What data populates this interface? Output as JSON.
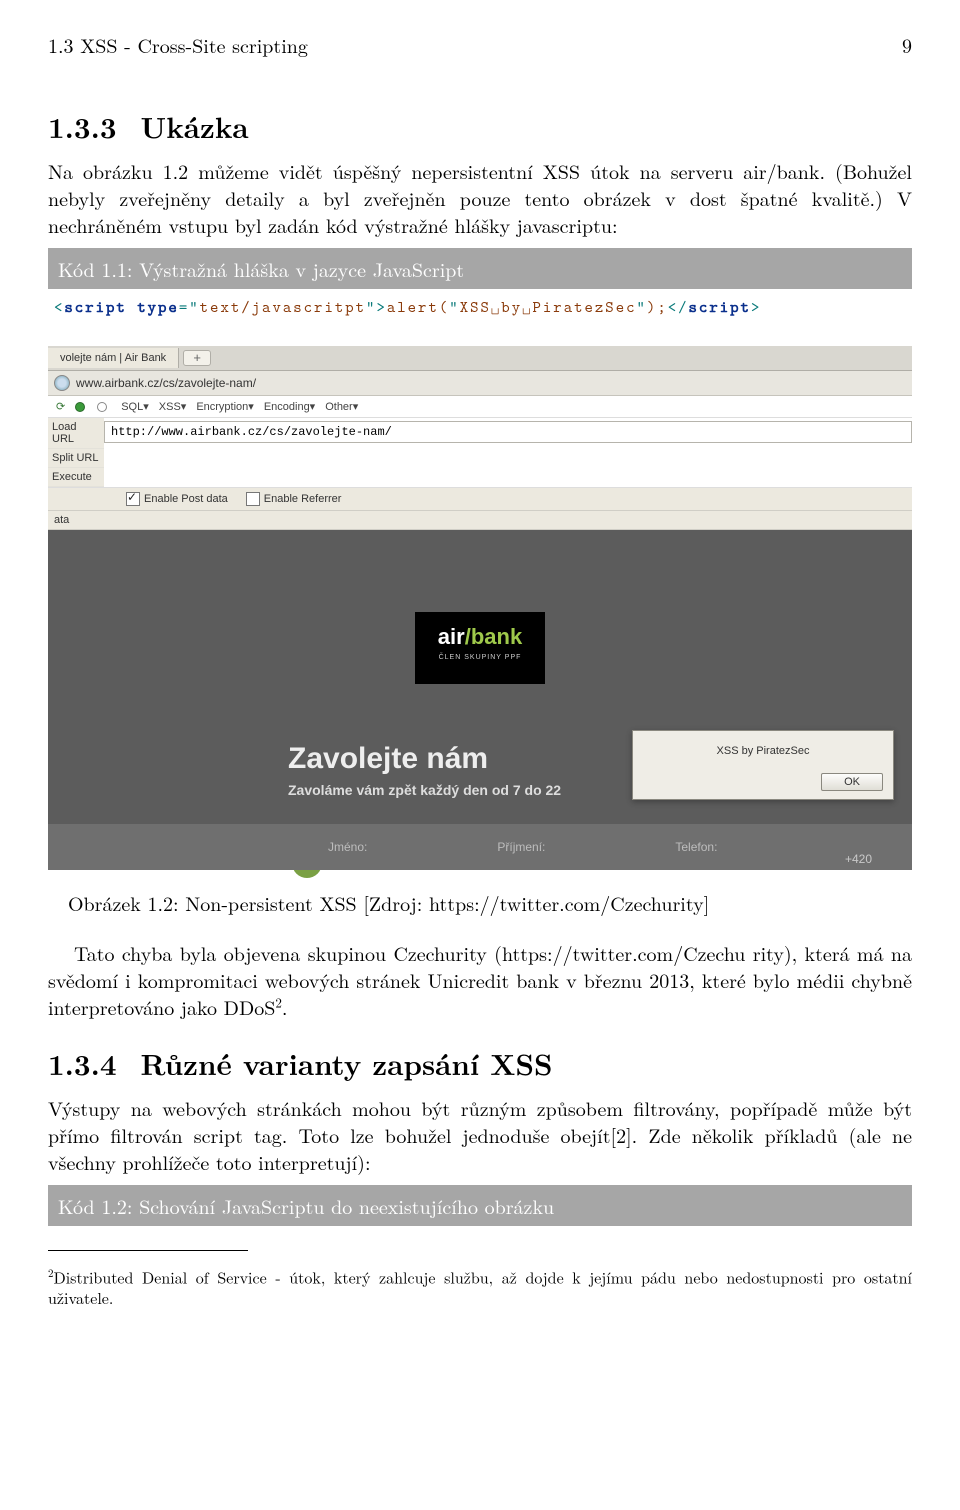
{
  "header": {
    "running": "1.3 XSS - Cross-Site scripting",
    "page": "9"
  },
  "sec133": {
    "num": "1.3.3",
    "title": "Ukázka",
    "p1": "Na obrázku 1.2 můžeme vidět úspěšný nepersistentní XSS útok na serveru air/bank. (Bohužel nebyly zveřejněny detaily a byl zveřejněn pouze tento obrázek v dost špatné kvalitě.) V nechráněném vstupu byl zadán kód výstražné hlášky javascriptu:"
  },
  "code1": {
    "title": "Kód 1.1: Výstražná hláška v jazyce JavaScript",
    "tok": {
      "lt1": "<",
      "script": "script",
      "sp": " ",
      "type": "type",
      "eq": "=\"",
      "typeval": "text/javascritpt",
      "q": "\"",
      "gt": ">",
      "alert": "alert",
      "op": "(",
      "q2": "\"",
      "msg": "XSS␣by␣PiratezSec",
      "q3": "\"",
      "cp": ")",
      "sc": ";",
      "lt2": "</",
      "gt2": ">"
    }
  },
  "shot": {
    "tab": "volejte nám | Air Bank",
    "url_display": "www.airbank.cz/cs/zavolejte-nam/",
    "menu": [
      "SQL▾",
      "XSS▾",
      "Encryption▾",
      "Encoding▾",
      "Other▾"
    ],
    "side": {
      "load": "Load URL",
      "split": "Split URL",
      "exec": "Execute",
      "ata": "ata"
    },
    "load_value": "http://www.airbank.cz/cs/zavolejte-nam/",
    "chk_post": "Enable Post data",
    "chk_ref": "Enable Referrer",
    "logo": {
      "air": "air",
      "bank": "bank",
      "sub": "ČLEN SKUPINY PPF"
    },
    "hero_title": "Zavolejte nám",
    "hero_sub": "Zavoláme vám zpět každý den od 7 do 22",
    "alert_msg": "XSS by PiratezSec",
    "alert_ok": "OK",
    "form": {
      "jmeno": "Jméno:",
      "prijmeni": "Příjmení:",
      "telefon": "Telefon:",
      "prefix": "+420"
    }
  },
  "caption": "Obrázek 1.2: Non-persistent XSS [Zdroj: https://twitter.com/Czechurity]",
  "p_after": "Tato chyba byla objevena skupinou Czechurity (https://twitter.com/Czechu rity), která má na svědomí i kompromitaci webových stránek Unicredit bank v březnu 2013, které bylo médii chybně interpretováno jako DDoS",
  "p_after_sup": "2",
  "p_after_tail": ".",
  "sec134": {
    "num": "1.3.4",
    "title": "Různé varianty zapsání XSS",
    "p": "Výstupy na webových stránkách mohou být různým způsobem filtrovány, popřípadě může být přímo filtrován script tag. Toto lze bohužel jednoduše obejít[2]. Zde několik příkladů (ale ne všechny prohlížeče toto interpretují):"
  },
  "code2": {
    "title": "Kód 1.2: Schování JavaScriptu do neexistujícího obrázku"
  },
  "footnote": {
    "marker": "2",
    "text": "Distributed Denial of Service - útok, který zahlcuje službu, až dojde k jejímu pádu nebo nedostupnosti pro ostatní uživatele."
  }
}
